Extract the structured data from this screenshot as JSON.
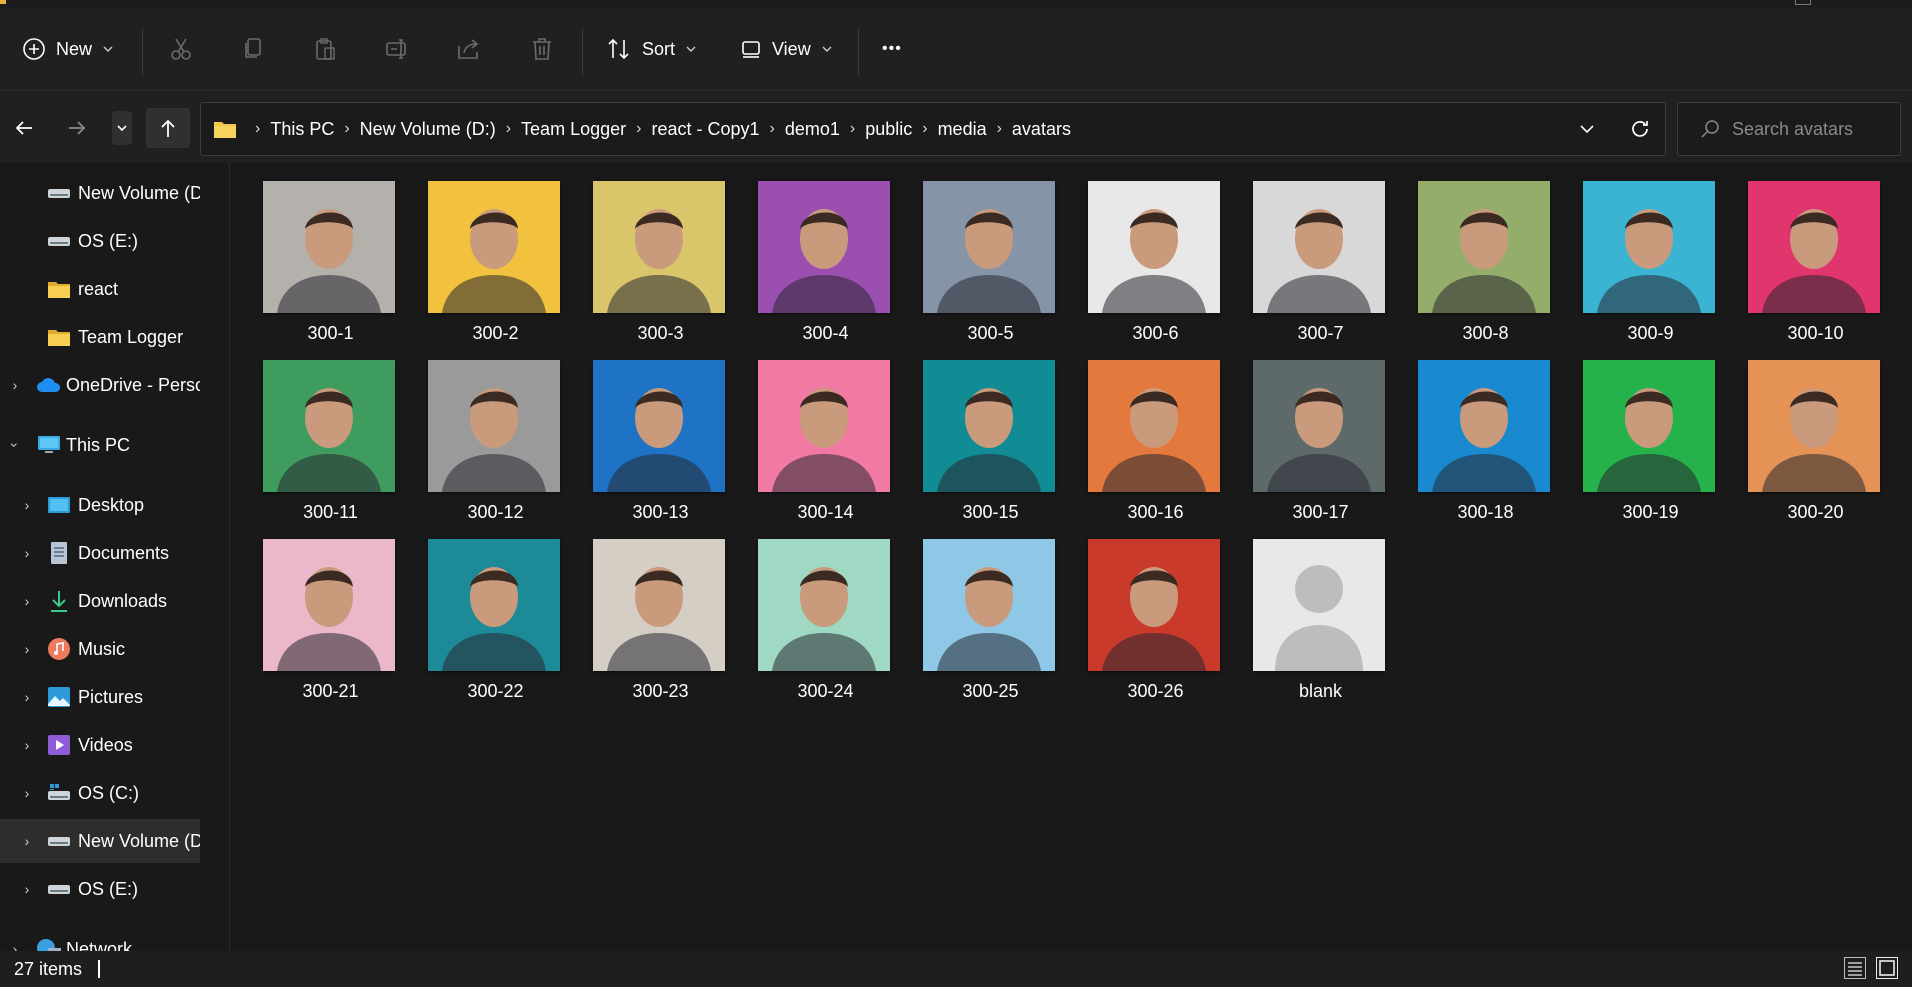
{
  "toolbar": {
    "new_label": "New",
    "sort_label": "Sort",
    "view_label": "View",
    "more_label": "•••"
  },
  "address": {
    "crumbs": [
      "This PC",
      "New Volume (D:)",
      "Team Logger",
      "react - Copy1",
      "demo1",
      "public",
      "media",
      "avatars"
    ]
  },
  "search": {
    "placeholder": "Search avatars"
  },
  "sidebar": {
    "items": [
      {
        "label": "New Volume (D",
        "icon": "drive-icon"
      },
      {
        "label": "OS (E:)",
        "icon": "drive-icon"
      },
      {
        "label": "react",
        "icon": "folder-icon"
      },
      {
        "label": "Team Logger",
        "icon": "folder-icon"
      },
      {
        "label": "OneDrive - Perso",
        "icon": "cloud-icon"
      },
      {
        "label": "This PC",
        "icon": "monitor-icon"
      },
      {
        "label": "Desktop",
        "icon": "desktop-icon"
      },
      {
        "label": "Documents",
        "icon": "documents-icon"
      },
      {
        "label": "Downloads",
        "icon": "download-icon"
      },
      {
        "label": "Music",
        "icon": "music-icon"
      },
      {
        "label": "Pictures",
        "icon": "pictures-icon"
      },
      {
        "label": "Videos",
        "icon": "videos-icon"
      },
      {
        "label": "OS (C:)",
        "icon": "windows-drive-icon"
      },
      {
        "label": "New Volume (D",
        "icon": "drive-icon"
      },
      {
        "label": "OS (E:)",
        "icon": "drive-icon"
      },
      {
        "label": "Network",
        "icon": "network-icon"
      }
    ]
  },
  "files": [
    {
      "name": "300-1",
      "color": "#b4b0ac"
    },
    {
      "name": "300-2",
      "color": "#f2c23e"
    },
    {
      "name": "300-3",
      "color": "#d9c56a"
    },
    {
      "name": "300-4",
      "color": "#9b4fb0"
    },
    {
      "name": "300-5",
      "color": "#8595a7"
    },
    {
      "name": "300-6",
      "color": "#e8e8e8"
    },
    {
      "name": "300-7",
      "color": "#d8d8d8"
    },
    {
      "name": "300-8",
      "color": "#95ad6a"
    },
    {
      "name": "300-9",
      "color": "#3ab4d2"
    },
    {
      "name": "300-10",
      "color": "#e0356d"
    },
    {
      "name": "300-11",
      "color": "#3e9c5e"
    },
    {
      "name": "300-12",
      "color": "#9a9a9a"
    },
    {
      "name": "300-13",
      "color": "#1e73c4"
    },
    {
      "name": "300-14",
      "color": "#f07aa4"
    },
    {
      "name": "300-15",
      "color": "#118c94"
    },
    {
      "name": "300-16",
      "color": "#e3793d"
    },
    {
      "name": "300-17",
      "color": "#5e6a6a"
    },
    {
      "name": "300-18",
      "color": "#1a8ad0"
    },
    {
      "name": "300-19",
      "color": "#26b24a"
    },
    {
      "name": "300-20",
      "color": "#e49256"
    },
    {
      "name": "300-21",
      "color": "#eab8c8"
    },
    {
      "name": "300-22",
      "color": "#1d8a98"
    },
    {
      "name": "300-23",
      "color": "#d5cec5"
    },
    {
      "name": "300-24",
      "color": "#9fd9c3"
    },
    {
      "name": "300-25",
      "color": "#8fc8e6"
    },
    {
      "name": "300-26",
      "color": "#c93a2a"
    },
    {
      "name": "blank",
      "color": "#e8e8e8"
    }
  ],
  "status": {
    "count": "27 items"
  },
  "colors": {
    "accent": "#e7b13b",
    "folder": "#f2c744",
    "onedrive": "#1f8ef1"
  }
}
